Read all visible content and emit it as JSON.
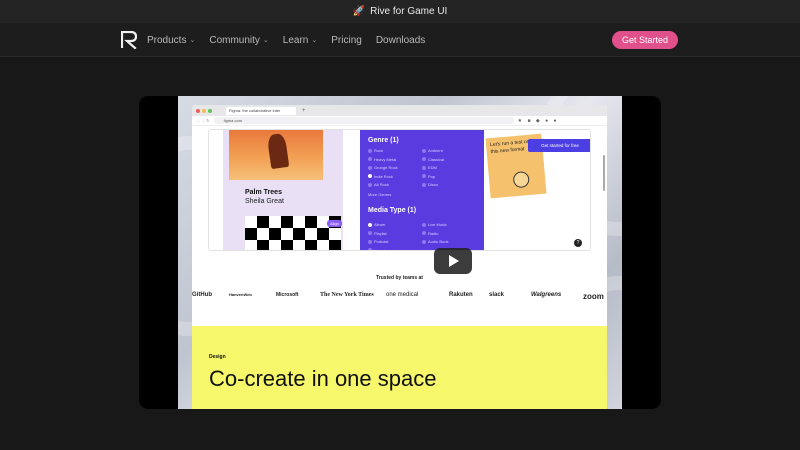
{
  "announcement": {
    "emoji": "🚀",
    "text": "Rive for Game UI"
  },
  "nav": {
    "items": [
      {
        "label": "Products",
        "dropdown": true
      },
      {
        "label": "Community",
        "dropdown": true
      },
      {
        "label": "Learn",
        "dropdown": true
      },
      {
        "label": "Pricing",
        "dropdown": false
      },
      {
        "label": "Downloads",
        "dropdown": false
      }
    ],
    "chevron": "⌄",
    "cta_label": "Get Started",
    "cta_color": "#e0508b"
  },
  "video": {
    "browser": {
      "tab_title": "Figma: the collaborative inter",
      "url": "figma.com",
      "new_tab": "+"
    },
    "card": {
      "song_title": "Palm Trees",
      "artist": "Sheila Great",
      "align_label": "Align",
      "genre_heading": "Genre (1)",
      "genres": [
        {
          "label": "Rock",
          "on": false
        },
        {
          "label": "Ambient",
          "on": false
        },
        {
          "label": "Heavy Metal",
          "on": false
        },
        {
          "label": "Classical",
          "on": false
        },
        {
          "label": "Grunge Rock",
          "on": false
        },
        {
          "label": "EDM",
          "on": false
        },
        {
          "label": "Indie Rock",
          "on": true
        },
        {
          "label": "Pop",
          "on": false
        },
        {
          "label": "Alt Rock",
          "on": false
        },
        {
          "label": "Disco",
          "on": false
        }
      ],
      "more_genres": "More Genres",
      "media_heading": "Media Type (1)",
      "media": [
        {
          "label": "Album",
          "on": true
        },
        {
          "label": "Live Music",
          "on": false
        },
        {
          "label": "Playlist",
          "on": false
        },
        {
          "label": "Radio",
          "on": false
        },
        {
          "label": "Podcast",
          "on": false
        },
        {
          "label": "Audio Book",
          "on": false
        },
        {
          "label": "Interview",
          "on": false
        }
      ],
      "sticky_note": "Let's run a test on this new format",
      "get_started_free": "Get started for free",
      "help": "?"
    },
    "trusted_label": "Trusted by teams at",
    "brands": [
      "GitHub",
      "HanvenWeb",
      "Microsoft",
      "The New York Times",
      "one medical",
      "Rakuten",
      "slack",
      "Walgreens",
      "zoom"
    ],
    "section_tag": "Design",
    "headline": "Co-create in one space",
    "accent_yellow": "#f6f76a",
    "accent_purple": "#5a3be0"
  }
}
